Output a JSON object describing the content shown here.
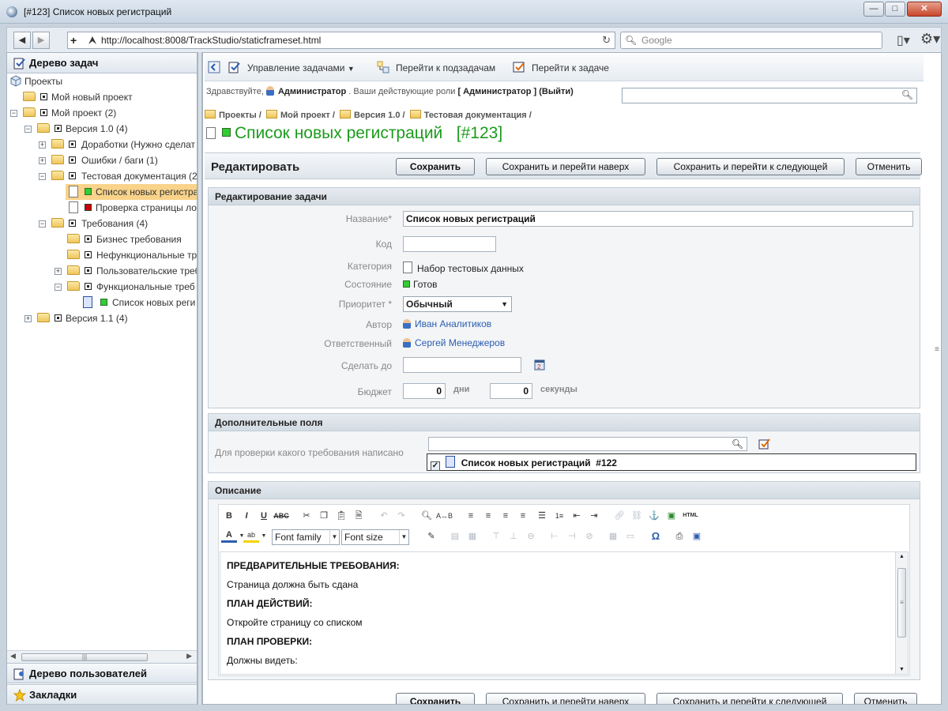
{
  "window": {
    "title": "[#123] Список новых регистраций",
    "controls": {
      "minimize": "—",
      "maximize": "□",
      "close": "✕"
    }
  },
  "browser": {
    "url": "http://localhost:8008/TrackStudio/staticframeset.html",
    "search_placeholder": "Google"
  },
  "left_panel": {
    "task_tree_title": "Дерево задач",
    "users_tree_title": "Дерево пользователей",
    "bookmarks_title": "Закладки",
    "tree": [
      {
        "label": "Проекты",
        "level": 0
      },
      {
        "label": "Мой новый проект",
        "level": 1
      },
      {
        "label": "Мой проект (2)",
        "level": 1
      },
      {
        "label": "Версия 1.0 (4)",
        "level": 2
      },
      {
        "label": "Доработки (Нужно сделат",
        "level": 3
      },
      {
        "label": "Ошибки / баги (1)",
        "level": 3
      },
      {
        "label": "Тестовая документация (2)",
        "level": 3
      },
      {
        "label": "Список новых регистрац",
        "level": 4,
        "selected": true,
        "status": "green"
      },
      {
        "label": "Проверка страницы ло",
        "level": 4,
        "status": "red"
      },
      {
        "label": "Требования (4)",
        "level": 3
      },
      {
        "label": "Бизнес требования",
        "level": 4
      },
      {
        "label": "Нефункциональные тр",
        "level": 4
      },
      {
        "label": "Пользовательские треб",
        "level": 4
      },
      {
        "label": "Функциональные треб",
        "level": 4
      },
      {
        "label": "Список новых реги",
        "level": 5,
        "status": "green"
      },
      {
        "label": "Версия 1.1 (4)",
        "level": 2
      }
    ]
  },
  "toolbar": {
    "manage_tasks": "Управление задачами",
    "go_subtasks": "Перейти к подзадачам",
    "go_task": "Перейти к задаче"
  },
  "welcome": {
    "greeting": "Здравствуйте,",
    "user": "Администратор",
    "roles_text": ". Ваши действующие роли",
    "role": "[ Администратор ]",
    "logout": "(Выйти)"
  },
  "breadcrumb": [
    "Проекты",
    "Мой проект",
    "Версия 1.0",
    "Тестовая документация"
  ],
  "page_title": "Список новых регистраций   [#123]",
  "edit_bar": {
    "heading": "Редактировать",
    "save": "Сохранить",
    "save_up": "Сохранить и перейти наверх",
    "save_next": "Сохранить и перейти к следующей",
    "cancel": "Отменить"
  },
  "edit_section": {
    "title": "Редактирование задачи",
    "fields": {
      "name_label": "Название*",
      "name_value": "Список новых регистраций",
      "code_label": "Код",
      "code_value": "",
      "category_label": "Категория",
      "category_value": "Набор тестовых данных",
      "state_label": "Состояние",
      "state_value": "Готов",
      "priority_label": "Приоритет *",
      "priority_value": "Обычный",
      "author_label": "Автор",
      "author_value": "Иван Аналитиков",
      "responsible_label": "Ответственный",
      "responsible_value": "Сергей Менеджеров",
      "deadline_label": "Сделать до",
      "deadline_value": "",
      "budget_label": "Бюджет",
      "budget_days": "0",
      "budget_days_unit": "дни",
      "budget_seconds": "0",
      "budget_seconds_unit": "секунды"
    }
  },
  "extra_section": {
    "title": "Дополнительные поля",
    "requirement_label": "Для проверки какого требования написано",
    "selected_item": "Список новых регистраций  #122"
  },
  "description_section": {
    "title": "Описание",
    "font_family": "Font family",
    "font_size": "Font size",
    "content": [
      {
        "text": "ПРЕДВАРИТЕЛЬНЫЕ ТРЕБОВАНИЯ:",
        "bold": true
      },
      {
        "text": "Страница должна быть сдана",
        "bold": false
      },
      {
        "text": "ПЛАН ДЕЙСТВИЙ:",
        "bold": true
      },
      {
        "text": "Откройте страницу со списком",
        "bold": false
      },
      {
        "text": "ПЛАН ПРОВЕРКИ:",
        "bold": true
      },
      {
        "text": "Должны видеть:",
        "bold": false
      }
    ]
  },
  "icons": {
    "browser": [
      "back-icon",
      "forward-icon",
      "reload-icon",
      "search-icon",
      "page-menu-icon",
      "gear-icon"
    ],
    "editor": [
      "bold-icon",
      "italic-icon",
      "underline-icon",
      "strikethrough-icon",
      "cut-icon",
      "copy-icon",
      "paste-icon",
      "paste-word-icon",
      "undo-icon",
      "redo-icon",
      "find-icon",
      "replace-icon",
      "align-left-icon",
      "align-center-icon",
      "align-right-icon",
      "justify-icon",
      "bullet-list-icon",
      "numbered-list-icon",
      "outdent-icon",
      "indent-icon",
      "link-icon",
      "unlink-icon",
      "anchor-icon",
      "image-icon",
      "html-icon",
      "text-color-icon",
      "highlight-color-icon",
      "edit-icon",
      "omega-icon",
      "print-icon",
      "fullscreen-icon"
    ]
  },
  "colors": {
    "title_green": "#1d9b1d",
    "link_blue": "#2a5db0",
    "status_green": "#33cc33",
    "status_red": "#cc0000",
    "selected_row": "#f9d38a"
  }
}
